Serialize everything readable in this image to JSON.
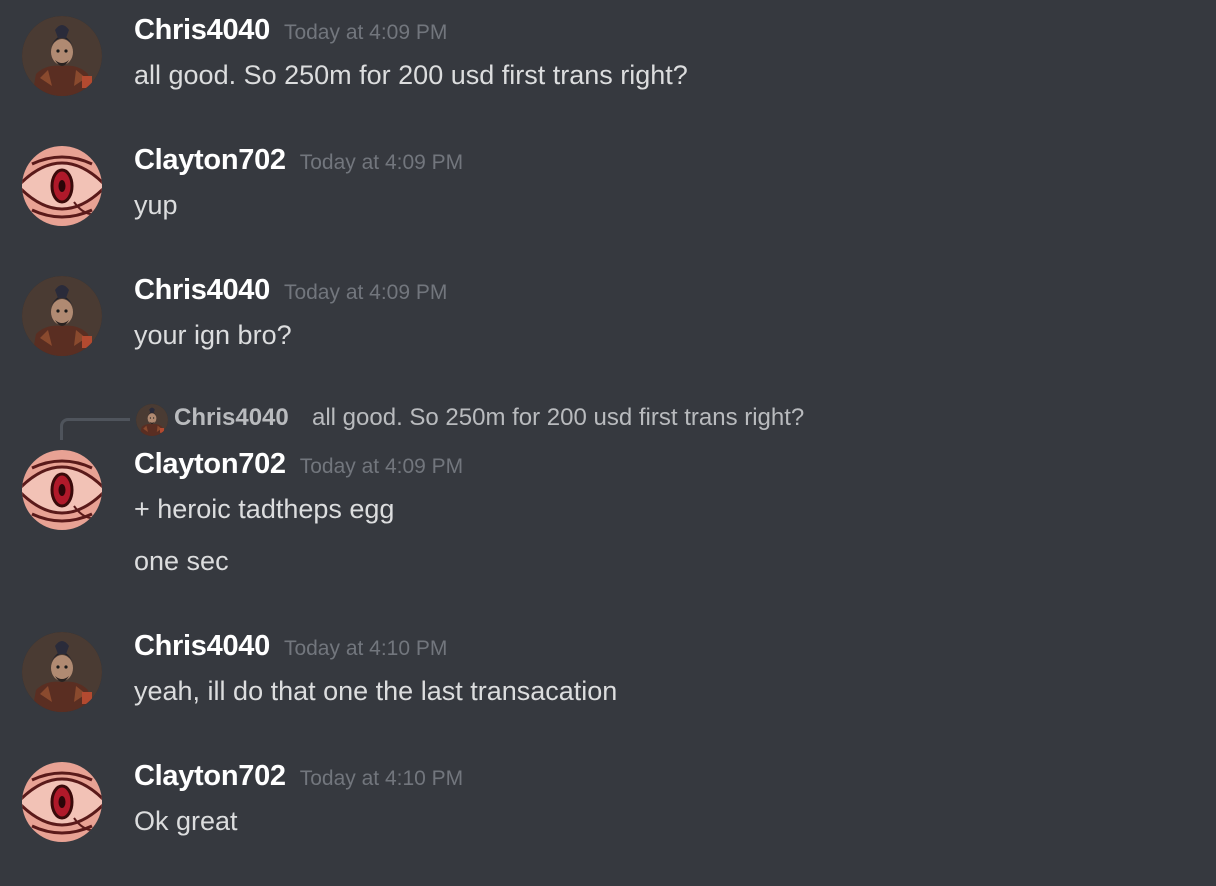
{
  "colors": {
    "background": "#36393f",
    "username": "#ffffff",
    "timestamp": "#72767d",
    "text": "#dcddde",
    "reply_text": "#b9bbbe"
  },
  "messages": [
    {
      "author": "Chris4040",
      "avatar_icon": "warrior-avatar-icon",
      "timestamp": "Today at 4:09 PM",
      "lines": [
        "all good. So 250m for 200 usd first trans right?"
      ]
    },
    {
      "author": "Clayton702",
      "avatar_icon": "red-eye-avatar-icon",
      "timestamp": "Today at 4:09 PM",
      "lines": [
        "yup"
      ]
    },
    {
      "author": "Chris4040",
      "avatar_icon": "warrior-avatar-icon",
      "timestamp": "Today at 4:09 PM",
      "lines": [
        "your ign bro?"
      ]
    },
    {
      "author": "Clayton702",
      "avatar_icon": "red-eye-avatar-icon",
      "timestamp": "Today at 4:09 PM",
      "reply_to": {
        "author": "Chris4040",
        "text": "all good. So 250m for 200 usd first trans right?"
      },
      "lines": [
        "+ heroic tadtheps egg",
        "one sec"
      ]
    },
    {
      "author": "Chris4040",
      "avatar_icon": "warrior-avatar-icon",
      "timestamp": "Today at 4:10 PM",
      "lines": [
        "yeah, ill do that one the last transacation"
      ]
    },
    {
      "author": "Clayton702",
      "avatar_icon": "red-eye-avatar-icon",
      "timestamp": "Today at 4:10 PM",
      "lines": [
        "Ok great"
      ]
    }
  ]
}
